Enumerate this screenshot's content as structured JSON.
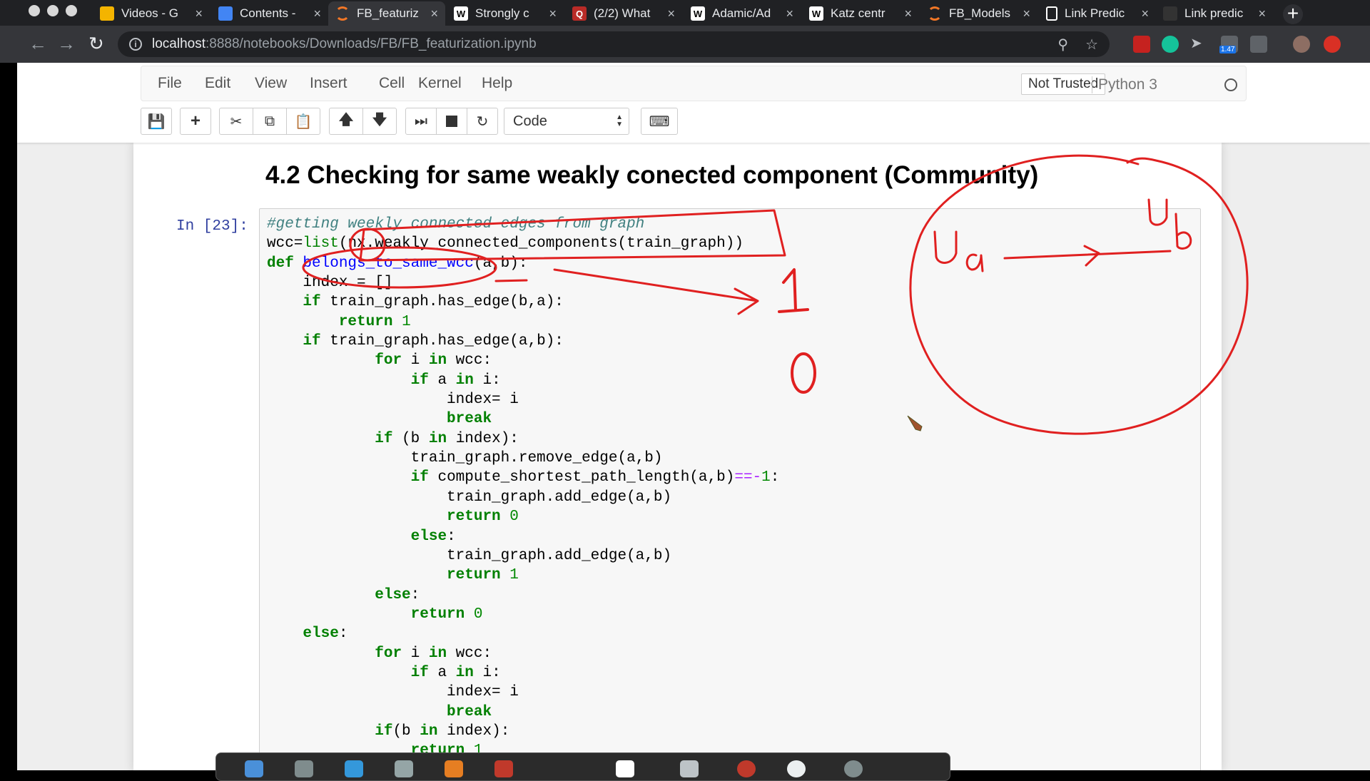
{
  "browser": {
    "tabs": [
      {
        "title": "Videos - G",
        "favicon": "google-drive-icon",
        "color": "#f4b400"
      },
      {
        "title": "Contents -",
        "favicon": "google-docs-icon",
        "color": "#4285f4"
      },
      {
        "title": "FB_featuriz",
        "favicon": "jupyter-icon",
        "color": "#f37726",
        "active": true
      },
      {
        "title": "Strongly c",
        "favicon": "wikipedia-icon",
        "color": "#ffffff"
      },
      {
        "title": "(2/2) What",
        "favicon": "quora-icon",
        "color": "#b92b27"
      },
      {
        "title": "Adamic/Ad",
        "favicon": "wikipedia-icon",
        "color": "#ffffff"
      },
      {
        "title": "Katz centr",
        "favicon": "wikipedia-icon",
        "color": "#ffffff"
      },
      {
        "title": "FB_Models",
        "favicon": "jupyter-icon",
        "color": "#f37726"
      },
      {
        "title": "Link Predic",
        "favicon": "document-icon",
        "color": "#ffffff"
      },
      {
        "title": "Link predic",
        "favicon": "github-icon",
        "color": "#333333"
      }
    ],
    "url_host": "localhost",
    "url_path": ":8888/notebooks/Downloads/FB/FB_featurization.ipynb",
    "extension_badge": "1.47"
  },
  "jupyter": {
    "menu": [
      "File",
      "Edit",
      "View",
      "Insert",
      "Cell",
      "Kernel",
      "Help"
    ],
    "trust_label": "Not Trusted",
    "kernel_name": "Python 3",
    "cell_type": "Code"
  },
  "notebook": {
    "heading": "4.2 Checking for same weakly conected component (Community)",
    "cell_prompt": "In [23]:",
    "code_lines": [
      "#getting weekly connected edges from graph",
      "wcc=list(nx.weakly_connected_components(train_graph))",
      "def belongs_to_same_wcc(a,b):",
      "    index = []",
      "    if train_graph.has_edge(b,a):",
      "        return 1",
      "    if train_graph.has_edge(a,b):",
      "            for i in wcc:",
      "                if a in i:",
      "                    index= i",
      "                    break",
      "            if (b in index):",
      "                train_graph.remove_edge(a,b)",
      "                if compute_shortest_path_length(a,b)==-1:",
      "                    train_graph.add_edge(a,b)",
      "                    return 0",
      "                else:",
      "                    train_graph.add_edge(a,b)",
      "                    return 1",
      "            else:",
      "                return 0",
      "    else:",
      "            for i in wcc:",
      "                if a in i:",
      "                    index= i",
      "                    break",
      "            if(b in index):",
      "                return 1"
    ]
  },
  "annotation_color": "#e02020"
}
